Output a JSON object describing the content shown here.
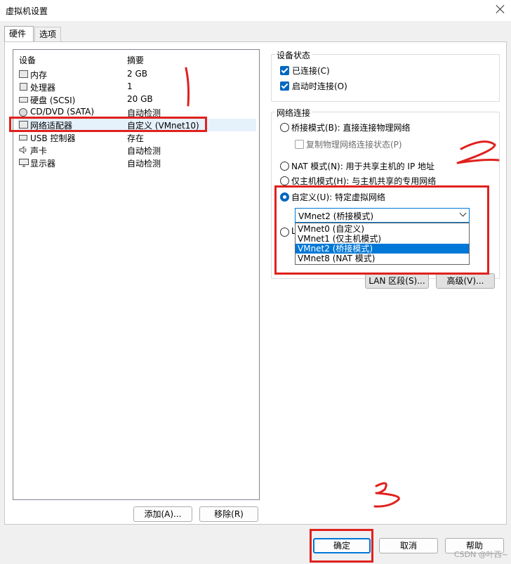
{
  "window": {
    "title": "虚拟机设置"
  },
  "tabs": [
    {
      "label": "硬件",
      "active": true
    },
    {
      "label": "选项",
      "active": false
    }
  ],
  "device_list": {
    "headers": {
      "device": "设备",
      "summary": "摘要"
    },
    "rows": [
      {
        "name": "内存",
        "summary": "2 GB",
        "icon": "memory-icon"
      },
      {
        "name": "处理器",
        "summary": "1",
        "icon": "cpu-icon"
      },
      {
        "name": "硬盘 (SCSI)",
        "summary": "20 GB",
        "icon": "harddisk-icon"
      },
      {
        "name": "CD/DVD (SATA)",
        "summary": "自动检测",
        "icon": "cd-icon"
      },
      {
        "name": "网络适配器",
        "summary": "自定义 (VMnet10)",
        "icon": "network-adapter-icon",
        "selected": true
      },
      {
        "name": "USB 控制器",
        "summary": "存在",
        "icon": "usb-icon"
      },
      {
        "name": "声卡",
        "summary": "自动检测",
        "icon": "speaker-icon"
      },
      {
        "name": "显示器",
        "summary": "自动检测",
        "icon": "monitor-icon"
      }
    ],
    "add_button": "添加(A)...",
    "remove_button": "移除(R)"
  },
  "device_status": {
    "legend": "设备状态",
    "connected": {
      "label": "已连接(C)",
      "checked": true
    },
    "connect_at_power_on": {
      "label": "启动时连接(O)",
      "checked": true
    }
  },
  "network_connection": {
    "legend": "网络连接",
    "bridged": {
      "label": "桥接模式(B): 直接连接物理网络",
      "selected": false
    },
    "replicate": {
      "label": "复制物理网络连接状态(P)",
      "checked": false
    },
    "nat": {
      "label": "NAT 模式(N): 用于共享主机的 IP 地址",
      "selected": false
    },
    "host_only": {
      "label": "仅主机模式(H): 与主机共享的专用网络",
      "selected": false
    },
    "custom": {
      "label": "自定义(U): 特定虚拟网络",
      "selected": true
    },
    "lan_radio_partial": "L",
    "combo_value": "VMnet2 (桥接模式)",
    "options": [
      "VMnet0 (自定义)",
      "VMnet1 (仅主机模式)",
      "VMnet2 (桥接模式)",
      "VMnet8 (NAT 模式)"
    ],
    "highlighted_option": "VMnet2 (桥接模式)",
    "lan_segments_button": "LAN 区段(S)...",
    "advanced_button": "高级(V)..."
  },
  "footer": {
    "ok": "确定",
    "cancel": "取消",
    "help": "帮助"
  },
  "watermark": "CSDN @叶西~",
  "colors": {
    "accent": "#0078d7",
    "annotation_red": "#e0211d"
  }
}
